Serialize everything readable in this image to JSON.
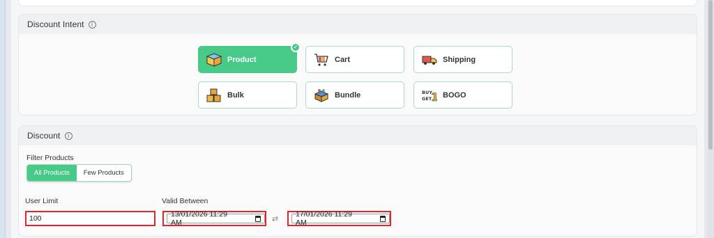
{
  "intent": {
    "title": "Discount Intent",
    "tiles": [
      {
        "label": "Product",
        "icon": "product-box-icon",
        "selected": true
      },
      {
        "label": "Cart",
        "icon": "cart-icon",
        "selected": false
      },
      {
        "label": "Shipping",
        "icon": "shipping-truck-icon",
        "selected": false
      },
      {
        "label": "Bulk",
        "icon": "bulk-boxes-icon",
        "selected": false
      },
      {
        "label": "Bundle",
        "icon": "bundle-box-icon",
        "selected": false
      },
      {
        "label": "BOGO",
        "icon": "bogo-icon",
        "selected": false
      }
    ]
  },
  "discount": {
    "title": "Discount",
    "filter_label": "Filter Products",
    "filter_options": [
      "All Products",
      "Few Products"
    ],
    "filter_selected": "All Products",
    "user_limit_label": "User Limit",
    "user_limit_value": "100",
    "valid_between_label": "Valid Between",
    "start_datetime": "13/01/2026 11:29 AM",
    "end_datetime": "17/01/2026 11:29 AM"
  },
  "colors": {
    "accent": "#47c988",
    "highlight": "#e4242a"
  }
}
